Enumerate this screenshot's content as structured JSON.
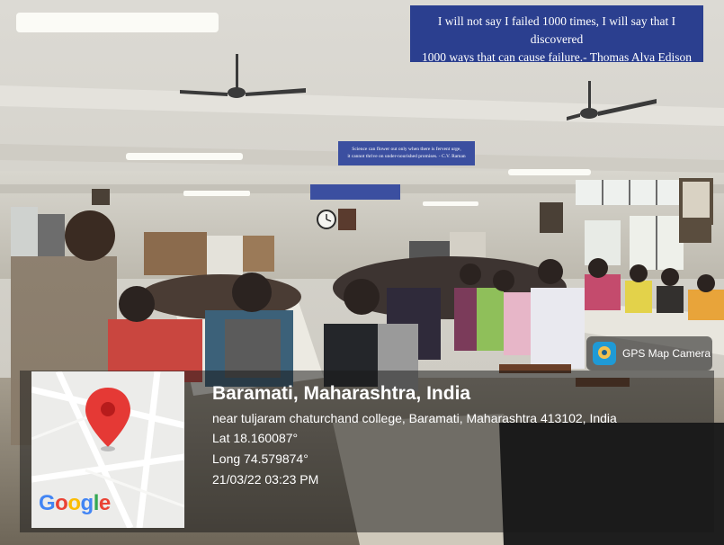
{
  "banners": {
    "top_quote": [
      "I will not say I failed 1000 times, I will say that I discovered",
      "1000 ways that can cause failure.- Thomas Alva Edison"
    ],
    "mid_quote": [
      "Science can flower out only when there is fervent urge,",
      "it cannot thrive on under-nourished promises. - C.V. Raman"
    ]
  },
  "gps_badge": {
    "label": "GPS Map Camera",
    "icon": "gps-map-camera-icon"
  },
  "map": {
    "logo_text": "Google",
    "pin_icon": "map-pin-icon",
    "pin_color": "#e53935"
  },
  "location": {
    "place": "Baramati, Maharashtra, India",
    "address": "near tuljaram chaturchand college, Baramati, Maharashtra 413102, India",
    "lat": "Lat 18.160087°",
    "long": "Long 74.579874°",
    "datetime": "21/03/22 03:23 PM"
  }
}
